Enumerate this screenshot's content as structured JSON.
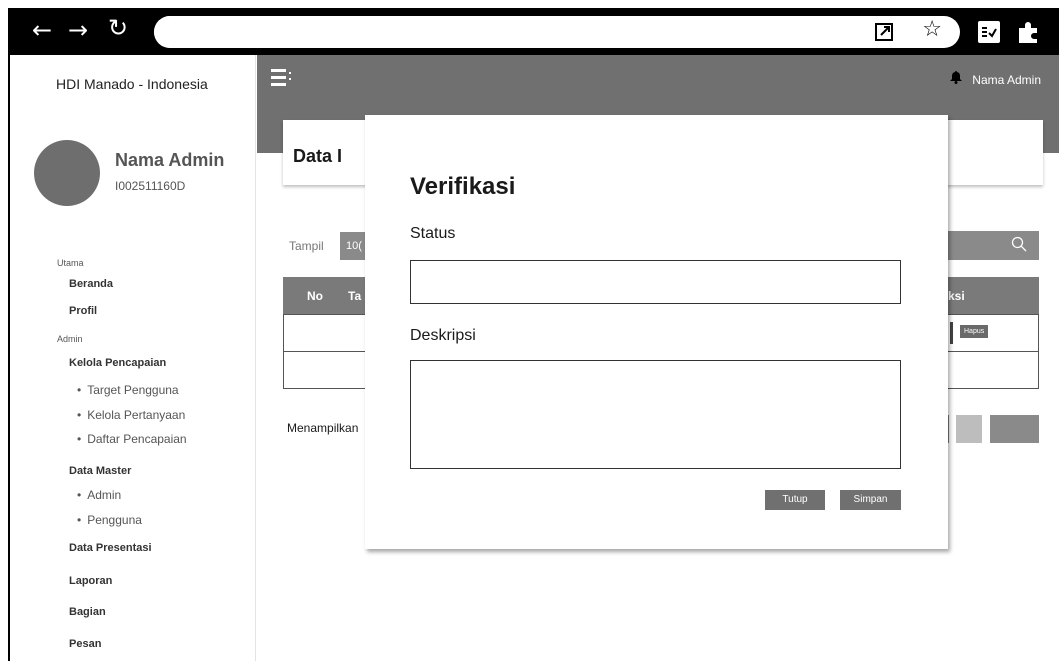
{
  "browser": {
    "back_icon": "←",
    "forward_icon": "→",
    "reload_icon": "↻",
    "star_icon": "☆"
  },
  "sidebar": {
    "brand": "HDI Manado - Indonesia",
    "user_name": "Nama Admin",
    "user_id": "I002511160D",
    "section_utama": "Utama",
    "beranda": "Beranda",
    "profil": "Profil",
    "section_admin": "Admin",
    "kelola_pencapaian": "Kelola Pencapaian",
    "target_pengguna": "Target Pengguna",
    "kelola_pertanyaan": "Kelola Pertanyaan",
    "daftar_pencapaian": "Daftar Pencapaian",
    "data_master": "Data Master",
    "admin": "Admin",
    "pengguna": "Pengguna",
    "data_presentasi": "Data Presentasi",
    "laporan": "Laporan",
    "bagian": "Bagian",
    "pesan": "Pesan"
  },
  "topbar": {
    "admin_name": "Nama Admin"
  },
  "page": {
    "title": "Data I",
    "tampil_label": "Tampil",
    "tampil_value": "10(",
    "col_no": "No",
    "col_ta": "Ta",
    "col_aksi": "ksi",
    "hapus": "Hapus",
    "menampilkan": "Menampilkan"
  },
  "modal": {
    "title": "Verifikasi",
    "status_label": "Status",
    "status_value": "",
    "deskripsi_label": "Deskripsi",
    "deskripsi_value": "",
    "tutup": "Tutup",
    "simpan": "Simpan"
  }
}
